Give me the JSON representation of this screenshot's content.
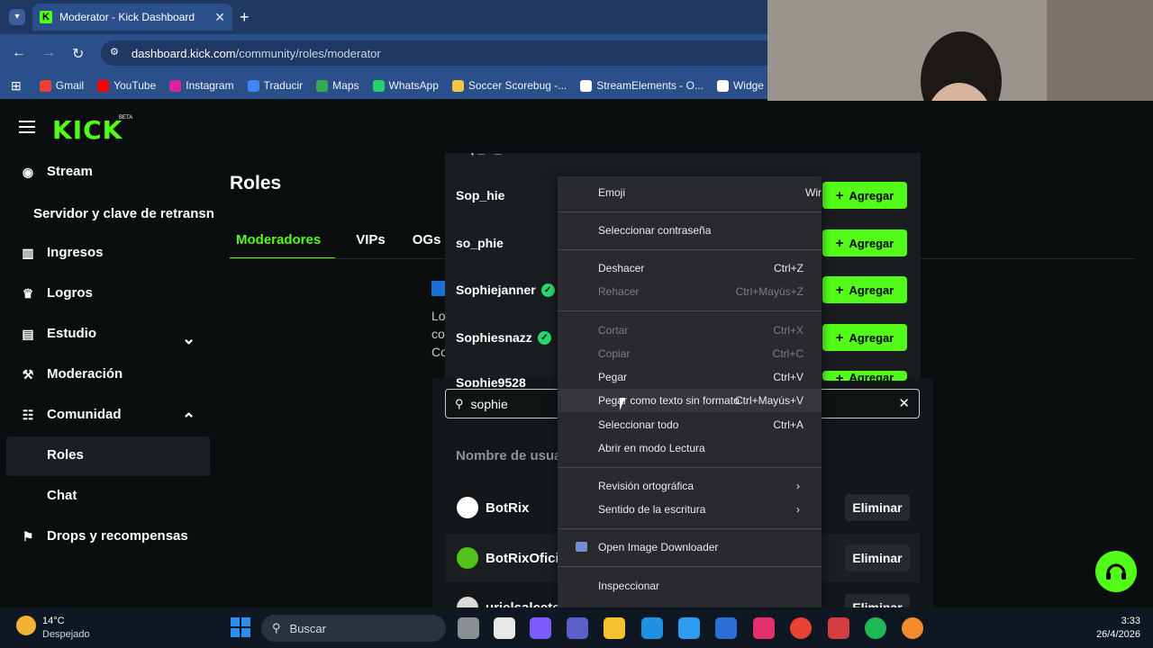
{
  "browser": {
    "tab_title": "Moderator - Kick Dashboard",
    "tab_favicon_letter": "K",
    "url_host": "dashboard.kick.com",
    "url_path": "/community/roles/moderator",
    "bookmarks": [
      {
        "label": "Gmail",
        "color": "#ea4335"
      },
      {
        "label": "YouTube",
        "color": "#ff0000"
      },
      {
        "label": "Instagram",
        "color": "#d6249f"
      },
      {
        "label": "Traducir",
        "color": "#4285f4"
      },
      {
        "label": "Maps",
        "color": "#34a853"
      },
      {
        "label": "WhatsApp",
        "color": "#25d366"
      },
      {
        "label": "Soccer Scorebug -...",
        "color": "#f5c542"
      },
      {
        "label": "StreamElements - O...",
        "color": "#ffffff"
      },
      {
        "label": "Widge",
        "color": "#ffffff"
      }
    ]
  },
  "sidebar": {
    "logo": "KICK",
    "logo_badge": "BETA",
    "items": [
      {
        "label": "Stream",
        "icon": "broadcast-icon"
      },
      {
        "label": "Servidor y clave de retransn",
        "icon": ""
      },
      {
        "label": "Ingresos",
        "icon": "chart-icon"
      },
      {
        "label": "Logros",
        "icon": "trophy-icon"
      },
      {
        "label": "Estudio",
        "icon": "studio-icon"
      },
      {
        "label": "Moderación",
        "icon": "wrench-icon"
      },
      {
        "label": "Comunidad",
        "icon": "community-icon"
      },
      {
        "label": "Roles",
        "icon": ""
      },
      {
        "label": "Chat",
        "icon": ""
      },
      {
        "label": "Drops y recompensas",
        "icon": "gift-icon"
      }
    ]
  },
  "main": {
    "title": "Roles",
    "tabs": [
      "Moderadores",
      "VIPs",
      "OGs"
    ],
    "info_lines": [
      "Lo",
      "co",
      "Co"
    ],
    "search_value": "sophie",
    "results": [
      {
        "name": "Sop_hie",
        "verified": false
      },
      {
        "name": "so_phie",
        "verified": false
      },
      {
        "name": "Sophiejanner",
        "verified": true
      },
      {
        "name": "Sophiesnazz",
        "verified": true
      },
      {
        "name": "Sophie9528",
        "verified": false
      }
    ],
    "add_label": "Agregar",
    "column_header": "Nombre de usua",
    "moderators": [
      {
        "name": "BotRix",
        "avatar_color": "#ffffff"
      },
      {
        "name": "BotRixOfici",
        "avatar_color": "#53c21a"
      },
      {
        "name": "urielsalcete",
        "avatar_color": "#d9d9d9"
      }
    ],
    "remove_label": "Eliminar"
  },
  "context_menu": {
    "items": [
      {
        "label": "Emoji",
        "shortcut": "Wir",
        "disabled": false
      },
      {
        "label": "Seleccionar contraseña",
        "shortcut": "",
        "disabled": false
      },
      {
        "label": "Deshacer",
        "shortcut": "Ctrl+Z",
        "disabled": false
      },
      {
        "label": "Rehacer",
        "shortcut": "Ctrl+Mayús+Z",
        "disabled": true
      },
      {
        "label": "Cortar",
        "shortcut": "Ctrl+X",
        "disabled": true
      },
      {
        "label": "Copiar",
        "shortcut": "Ctrl+C",
        "disabled": true
      },
      {
        "label": "Pegar",
        "shortcut": "Ctrl+V",
        "disabled": false
      },
      {
        "label": "Pegar como texto sin formato",
        "shortcut": "Ctrl+Mayús+V",
        "disabled": false
      },
      {
        "label": "Seleccionar todo",
        "shortcut": "Ctrl+A",
        "disabled": false
      },
      {
        "label": "Abrir en modo Lectura",
        "shortcut": "",
        "disabled": false
      },
      {
        "label": "Revisión ortográfica",
        "shortcut": "",
        "disabled": false
      },
      {
        "label": "Sentido de la escritura",
        "shortcut": "",
        "disabled": false
      },
      {
        "label": "Open Image Downloader",
        "shortcut": "",
        "disabled": false
      },
      {
        "label": "Inspeccionar",
        "shortcut": "",
        "disabled": false
      }
    ]
  },
  "taskbar": {
    "weather_temp": "14°C",
    "weather_desc": "Despejado",
    "search_placeholder": "Buscar",
    "time": "3:33",
    "date": "26/4/2026"
  },
  "colors": {
    "accent": "#53fc18",
    "bg": "#0b0e0f",
    "chrome": "#2b4f8a"
  }
}
